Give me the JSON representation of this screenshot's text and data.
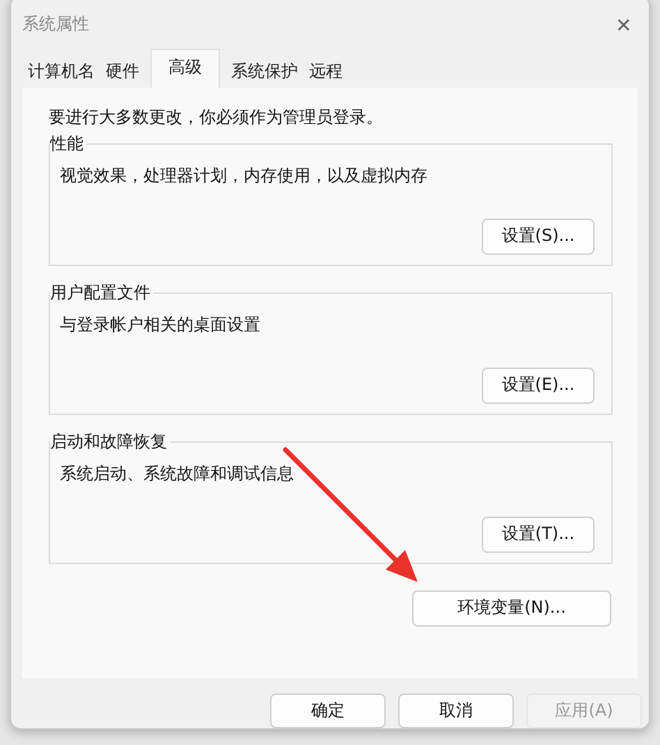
{
  "window": {
    "title": "系统属性",
    "close": "✕"
  },
  "tabs": [
    {
      "label": "计算机名",
      "selected": false
    },
    {
      "label": "硬件",
      "selected": false
    },
    {
      "label": "高级",
      "selected": true
    },
    {
      "label": "系统保护",
      "selected": false
    },
    {
      "label": "远程",
      "selected": false
    }
  ],
  "notice": "要进行大多数更改，你必须作为管理员登录。",
  "groups": [
    {
      "title": "性能",
      "description": "视觉效果，处理器计划，内存使用，以及虚拟内存",
      "button": "设置(S)..."
    },
    {
      "title": "用户配置文件",
      "description": "与登录帐户相关的桌面设置",
      "button": "设置(E)..."
    },
    {
      "title": "启动和故障恢复",
      "description": "系统启动、系统故障和调试信息",
      "button": "设置(T)..."
    }
  ],
  "env_button": "环境变量(N)...",
  "buttons": [
    {
      "label": "确定",
      "disabled": false
    },
    {
      "label": "取消",
      "disabled": false
    },
    {
      "label": "应用(A)",
      "disabled": true
    }
  ]
}
